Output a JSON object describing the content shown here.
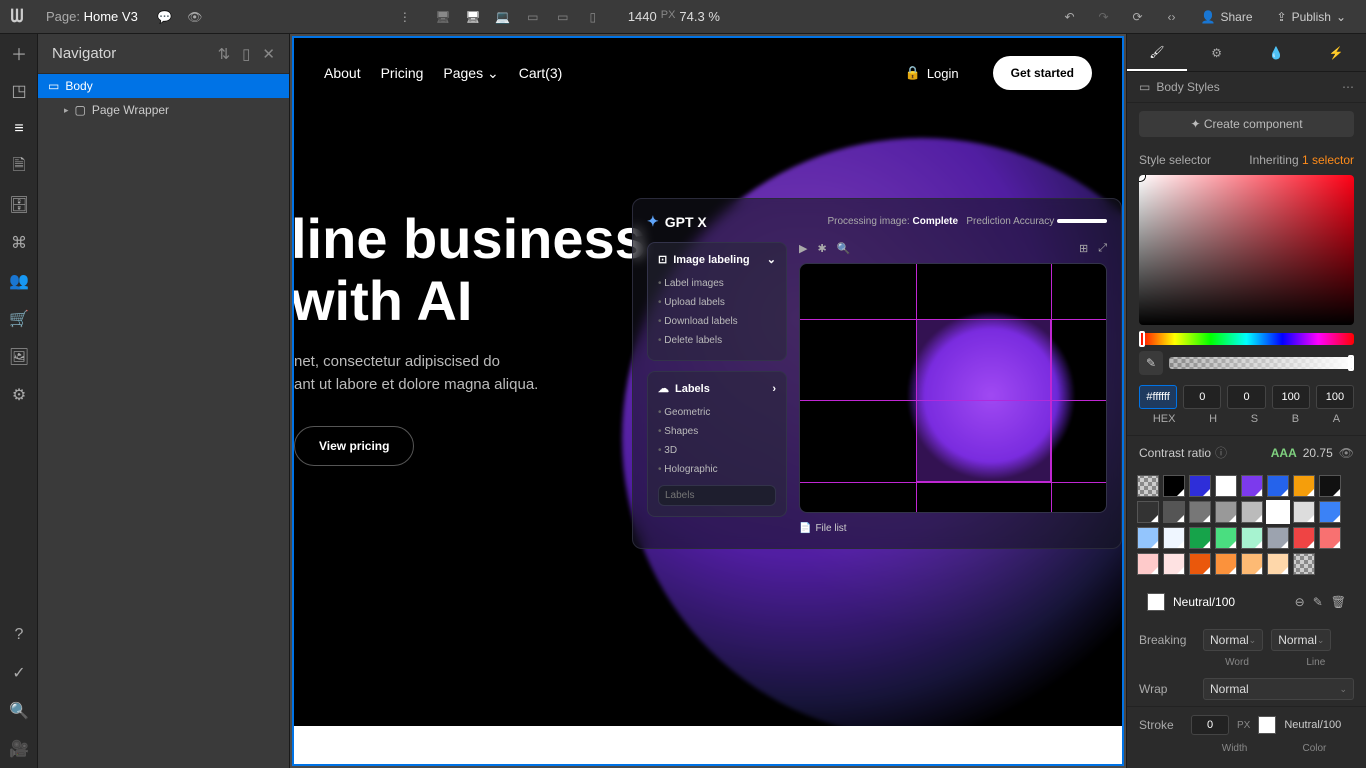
{
  "topbar": {
    "page_label": "Page:",
    "page_name": "Home V3",
    "viewport_width": "1440",
    "px_label": "PX",
    "zoom": "74.3 %",
    "share": "Share",
    "publish": "Publish"
  },
  "navigator": {
    "title": "Navigator",
    "items": [
      {
        "label": "Body",
        "selected": true
      },
      {
        "label": "Page Wrapper",
        "selected": false
      }
    ]
  },
  "canvas": {
    "nav": {
      "about": "About",
      "pricing": "Pricing",
      "pages": "Pages",
      "cart": "Cart(3)",
      "login": "Login",
      "getstarted": "Get started"
    },
    "hero": {
      "title_l1": "line business",
      "title_l2": "with AI",
      "body_l1": "net, consectetur adipiscised do",
      "body_l2": "ant ut labore et dolore magna aliqua.",
      "cta2": "View pricing"
    },
    "overlay": {
      "logo": "GPT X",
      "status_label": "Processing image:",
      "status_value": "Complete",
      "accuracy_label": "Prediction Accuracy",
      "sidebar1_title": "Image labeling",
      "sidebar1_items": [
        "Label images",
        "Upload labels",
        "Download labels",
        "Delete labels"
      ],
      "sidebar2_title": "Labels",
      "sidebar2_items": [
        "Geometric",
        "Shapes",
        "3D",
        "Holographic"
      ],
      "search_placeholder": "Labels",
      "filelist": "File list"
    }
  },
  "right_panel": {
    "body_styles": "Body Styles",
    "create_component": "Create component",
    "style_selector": "Style selector",
    "inheriting": "Inheriting",
    "inheriting_count": "1 selector",
    "hex": "#ffffff",
    "h": "0",
    "s": "0",
    "b": "100",
    "a": "100",
    "labels": {
      "hex": "HEX",
      "h": "H",
      "s": "S",
      "b": "B",
      "a": "A"
    },
    "contrast_label": "Contrast ratio",
    "contrast_rating": "AAA",
    "contrast_value": "20.75",
    "named_swatch": "Neutral/100",
    "breaking_label": "Breaking",
    "breaking_v1": "Normal",
    "breaking_v2": "Normal",
    "word": "Word",
    "line": "Line",
    "wrap_label": "Wrap",
    "wrap_value": "Normal",
    "stroke_label": "Stroke",
    "stroke_value": "0",
    "stroke_unit": "PX",
    "stroke_color": "Neutral/100",
    "width_label": "Width",
    "color_label": "Color"
  }
}
